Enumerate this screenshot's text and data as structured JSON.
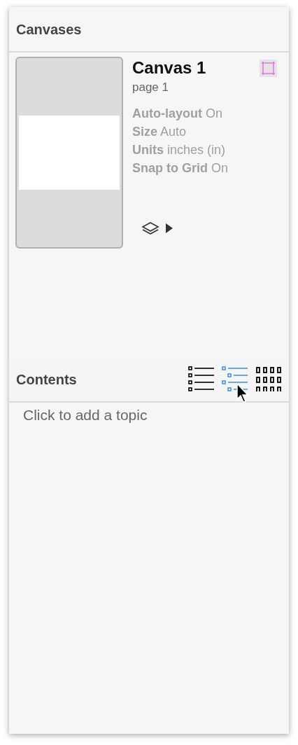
{
  "canvases": {
    "title": "Canvases",
    "items": [
      {
        "name": "Canvas 1",
        "page": "page 1",
        "selected": false,
        "properties": [
          {
            "label": "Auto-layout",
            "value": "On"
          },
          {
            "label": "Size",
            "value": "Auto"
          },
          {
            "label": "Units",
            "value": "inches (in)"
          },
          {
            "label": "Snap to Grid",
            "value": "On"
          }
        ]
      }
    ]
  },
  "contents": {
    "title": "Contents",
    "views": [
      {
        "kind": "list",
        "selected": false
      },
      {
        "kind": "outline",
        "selected": true
      },
      {
        "kind": "grid",
        "selected": false
      }
    ],
    "placeholder": "Click to add a topic"
  }
}
